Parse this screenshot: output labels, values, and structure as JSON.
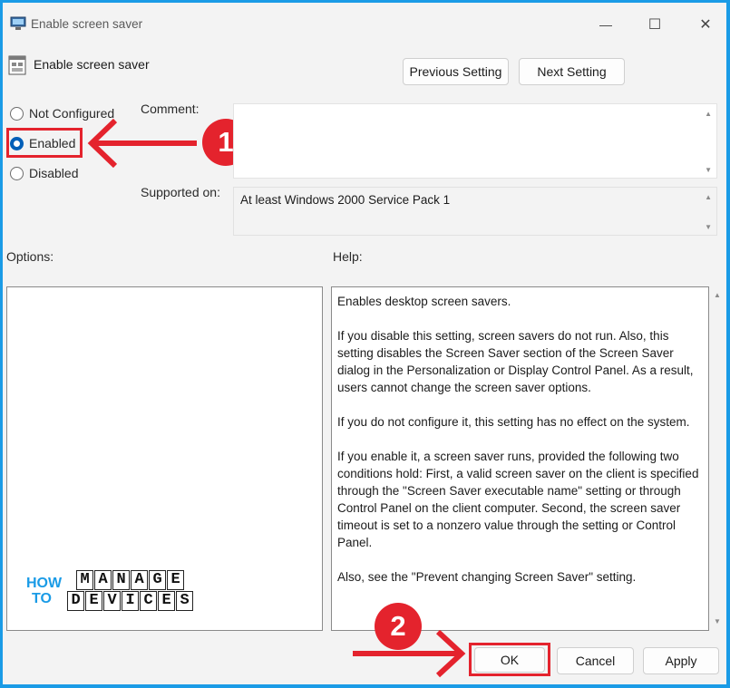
{
  "window": {
    "title": "Enable screen saver",
    "policy_name": "Enable screen saver",
    "controls": {
      "minimize": "—",
      "maximize": "☐",
      "close": "✕"
    }
  },
  "nav": {
    "previous_label": "Previous Setting",
    "next_label": "Next Setting"
  },
  "state": {
    "options": [
      {
        "label": "Not Configured",
        "checked": false
      },
      {
        "label": "Enabled",
        "checked": true
      },
      {
        "label": "Disabled",
        "checked": false
      }
    ]
  },
  "comment": {
    "label": "Comment:",
    "value": ""
  },
  "supported": {
    "label": "Supported on:",
    "value": "At least Windows 2000 Service Pack 1"
  },
  "options_pane": {
    "label": "Options:"
  },
  "help": {
    "label": "Help:",
    "text": "Enables desktop screen savers.\n\nIf you disable this setting, screen savers do not run. Also, this setting disables the Screen Saver section of the Screen Saver dialog in the Personalization or Display Control Panel. As a result, users cannot change the screen saver options.\n\nIf you do not configure it, this setting has no effect on the system.\n\nIf you enable it, a screen saver runs, provided the following two conditions hold: First, a valid screen saver on the client is specified through the \"Screen Saver executable name\" setting or through Control Panel on the client computer. Second, the screen saver timeout is set to a nonzero value through the setting or Control Panel.\n\nAlso, see the \"Prevent changing Screen Saver\" setting."
  },
  "footer": {
    "ok_label": "OK",
    "cancel_label": "Cancel",
    "apply_label": "Apply"
  },
  "annotations": {
    "step1": "1",
    "step2": "2",
    "accent_color": "#e4232d",
    "background_color": "#1a9be6"
  },
  "logo": {
    "how": "HOW",
    "to": "TO",
    "manage": "MANAGE",
    "devices": "DEVICES"
  }
}
